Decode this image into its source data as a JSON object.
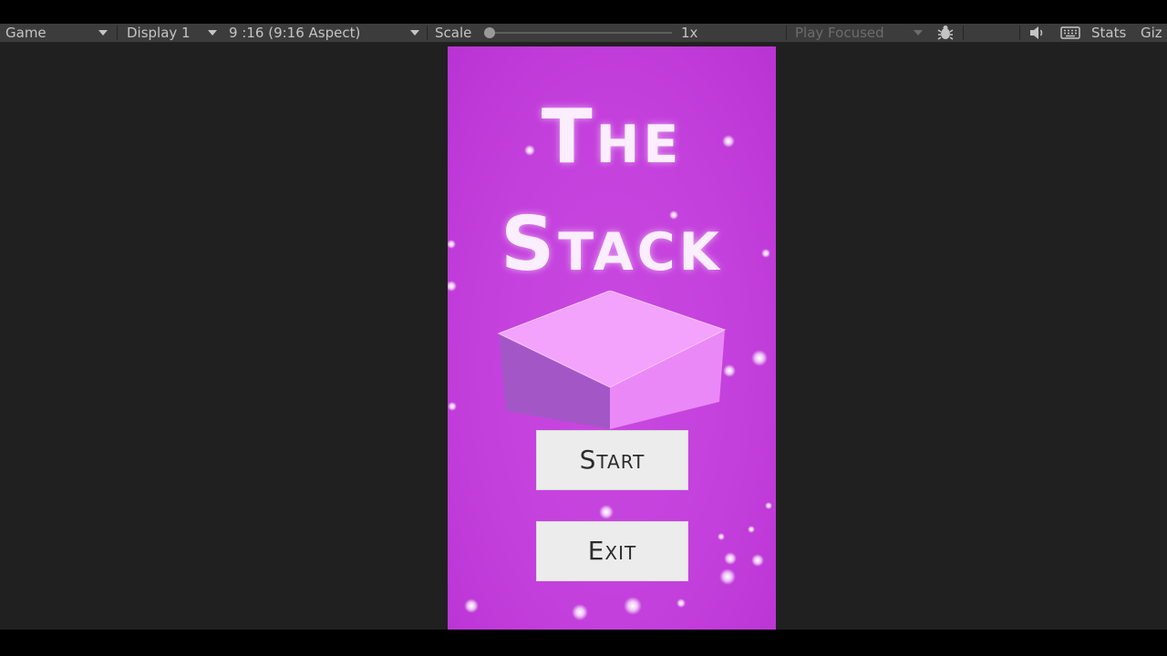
{
  "toolbar": {
    "view_label": "Game",
    "display_label": "Display 1",
    "aspect_label": "9 :16 (9:16 Aspect)",
    "scale_label": "Scale",
    "scale_value": "1x",
    "play_mode_label": "Play Focused",
    "stats_label": "Stats",
    "gizmos_label": "Giz"
  },
  "game": {
    "title_line1": "The",
    "title_line2": "Stack",
    "start_label": "Start",
    "exit_label": "Exit"
  },
  "colors": {
    "game_background": "#c33fdc",
    "cube_top": "#f3a3fb",
    "cube_left": "#a357c7",
    "cube_right": "#eb88f7",
    "button_bg": "#ececec",
    "toolbar_bg": "#3c3c3c"
  },
  "icons": [
    "dropdown-arrow-icon",
    "bug-icon",
    "speaker-icon",
    "keyboard-icon"
  ]
}
